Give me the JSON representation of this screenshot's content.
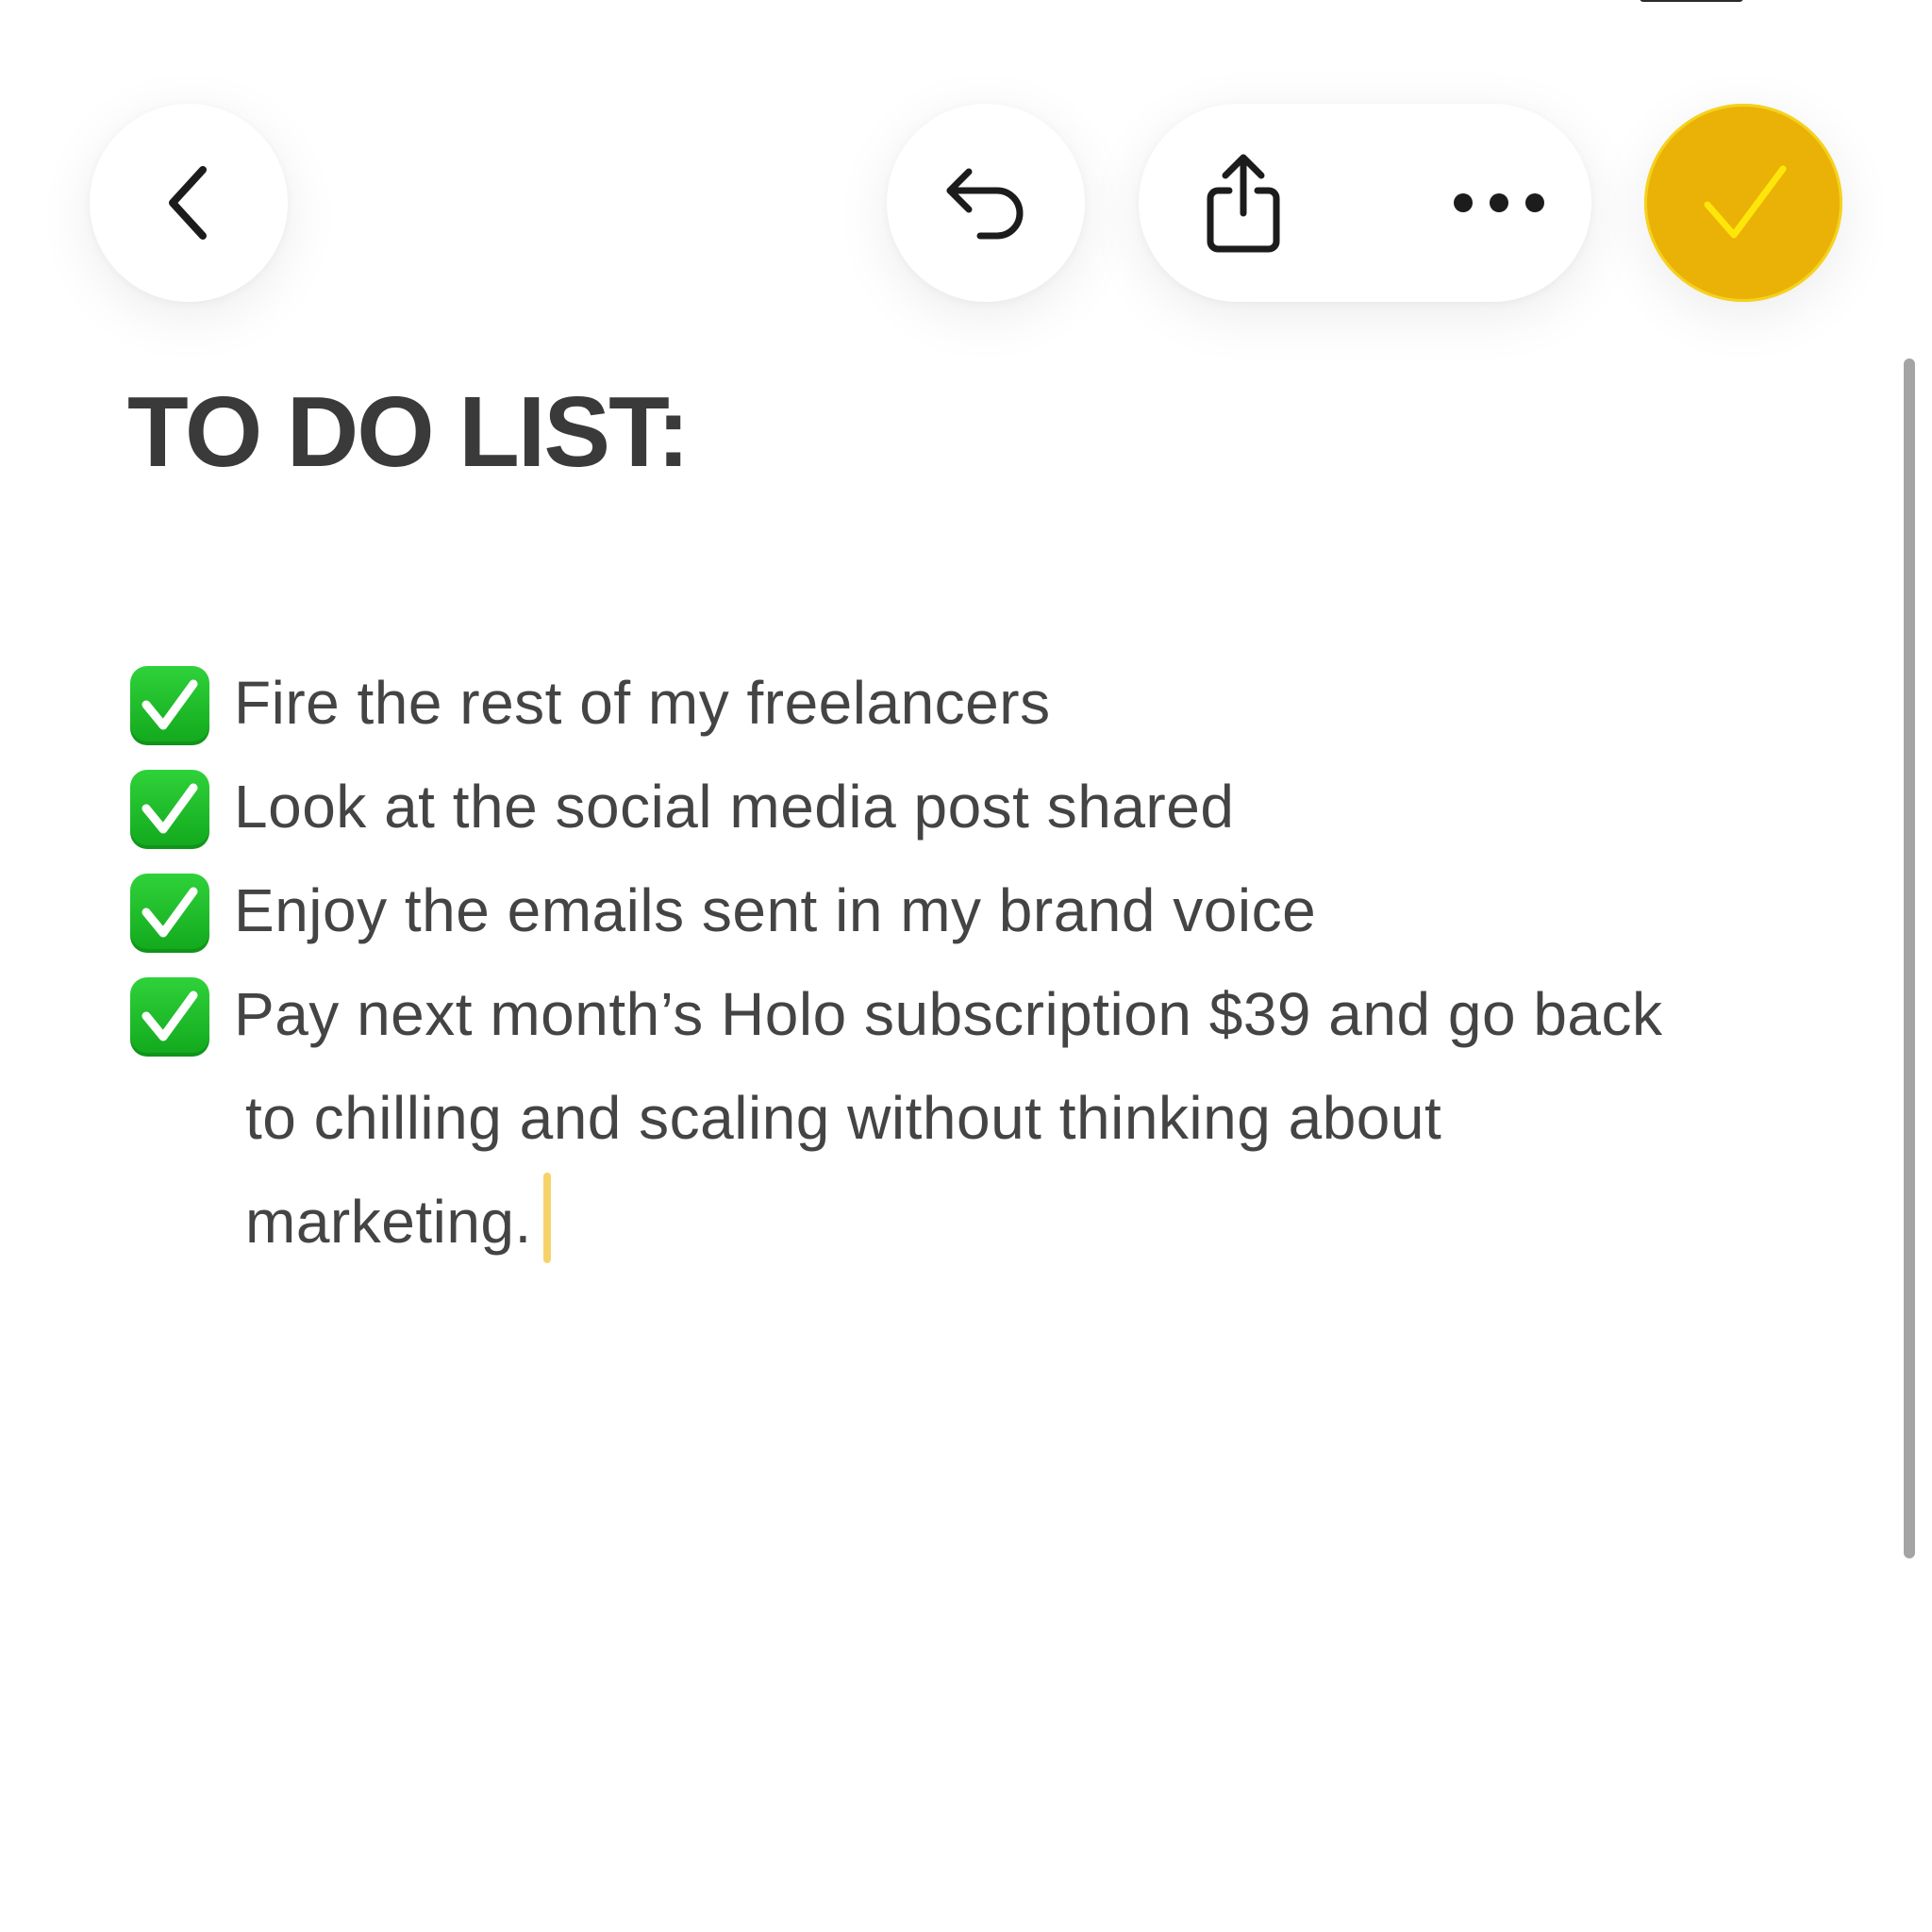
{
  "toolbar": {
    "back_icon": "chevron-left-icon",
    "undo_icon": "undo-arrow-icon",
    "share_icon": "share-icon",
    "more_icon": "ellipsis-icon",
    "done_icon": "checkmark-icon",
    "done_color": "#EAB106"
  },
  "note": {
    "title": "TO DO LIST:",
    "items": [
      {
        "checked": true,
        "text": "Fire the rest of my freelancers"
      },
      {
        "checked": true,
        "text": "Look at the social media post shared"
      },
      {
        "checked": true,
        "text": "Enjoy the emails sent in my brand voice"
      },
      {
        "checked": true,
        "text": "Pay next month’s Holo subscription $39 and go back to chilling and scaling without thinking about marketing."
      }
    ],
    "item_4_lines": [
      "Pay next month’s Holo subscription $39 and go back",
      "to chilling and scaling without thinking about",
      "marketing."
    ]
  },
  "colors": {
    "check_green": "#1BBE27",
    "text": "#444444",
    "title": "#3a3a3a",
    "caret": "#f6d36a"
  }
}
